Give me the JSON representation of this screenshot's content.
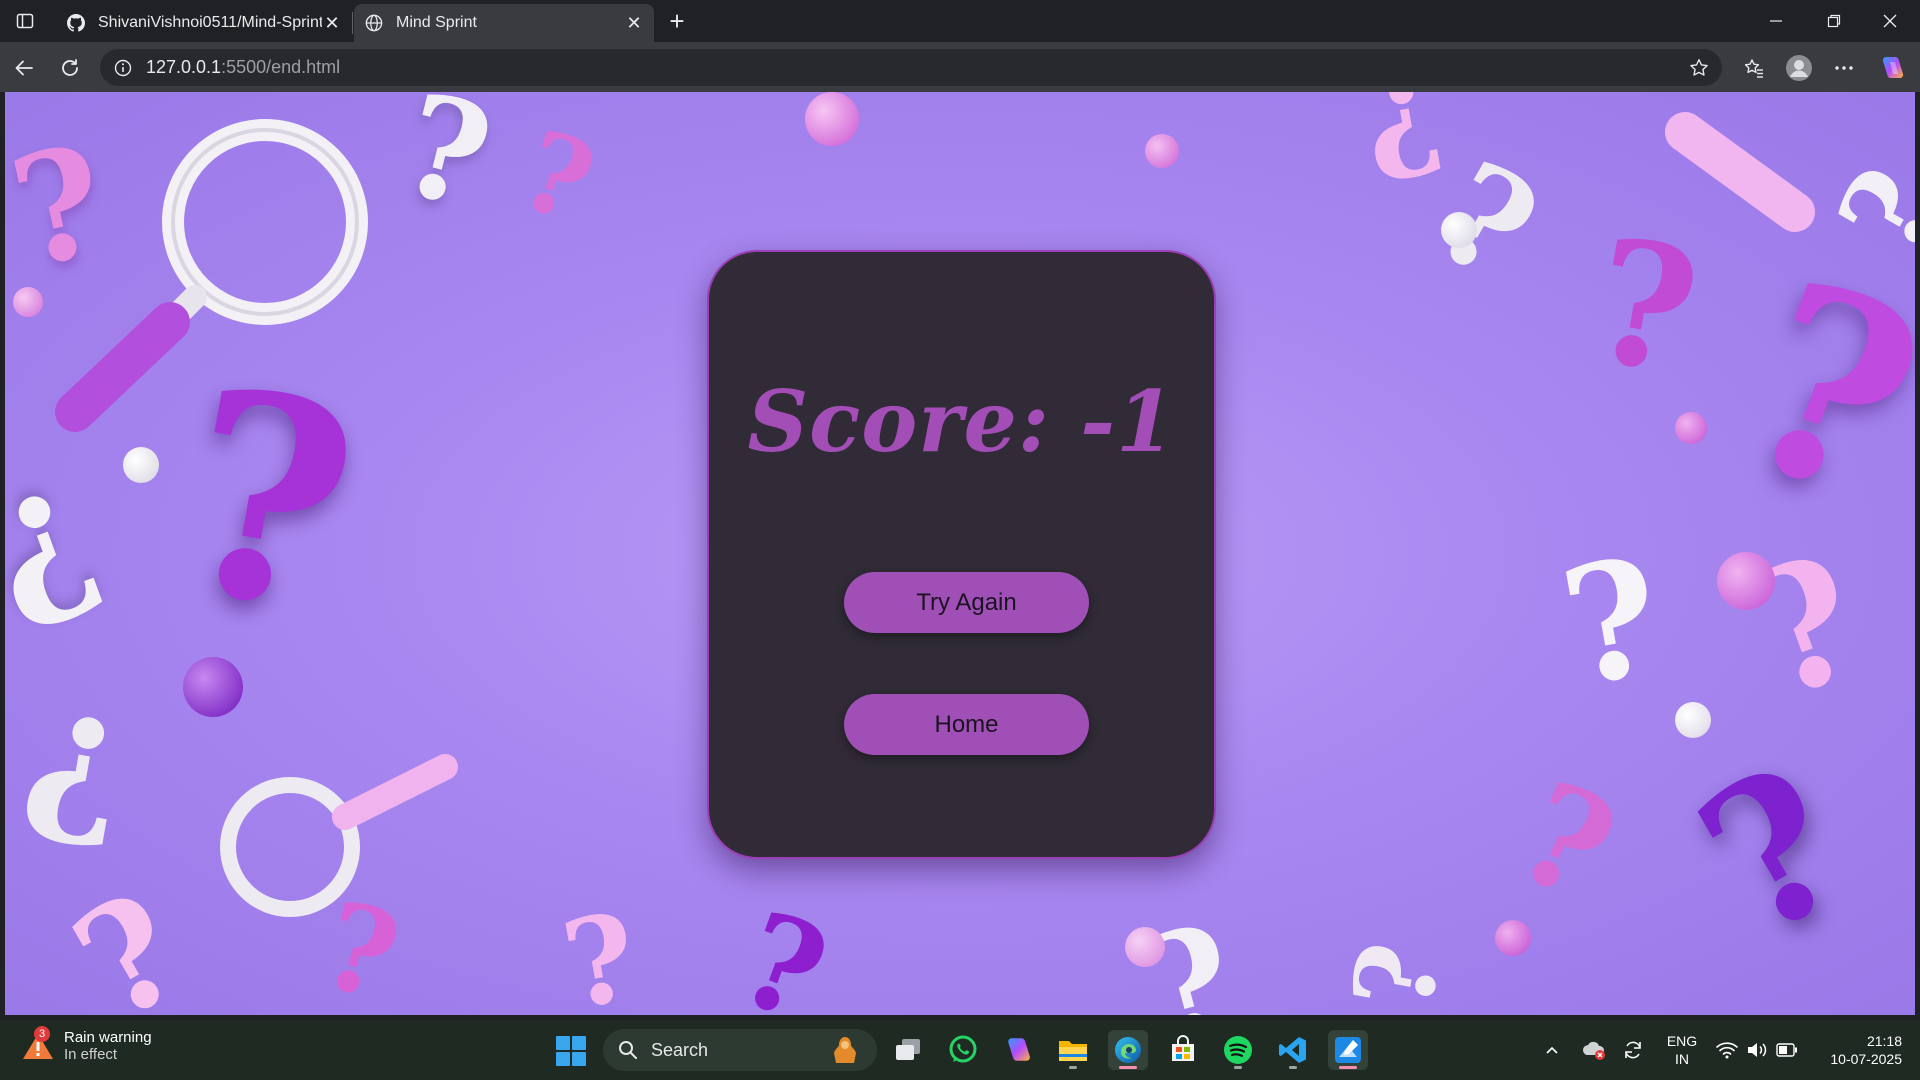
{
  "browser": {
    "tabs": [
      {
        "title": "ShivaniVishnoi0511/Mind-Sprint",
        "icon": "github-icon",
        "active": false
      },
      {
        "title": "Mind Sprint",
        "icon": "globe-icon",
        "active": true
      }
    ],
    "address": {
      "host": "127.0.0.1",
      "path": ":5500/end.html"
    }
  },
  "page": {
    "score_text": "Score: -1",
    "try_again_label": "Try Again",
    "home_label": "Home",
    "colors": {
      "accent": "#a04fb7",
      "card": "#302b36",
      "background": "#a887f0"
    }
  },
  "taskbar": {
    "weather": {
      "title": "Rain warning",
      "subtitle": "In effect",
      "badge": "3"
    },
    "search_label": "Search",
    "lang": {
      "line1": "ENG",
      "line2": "IN"
    },
    "clock": {
      "time": "21:18",
      "date": "10-07-2025"
    }
  }
}
